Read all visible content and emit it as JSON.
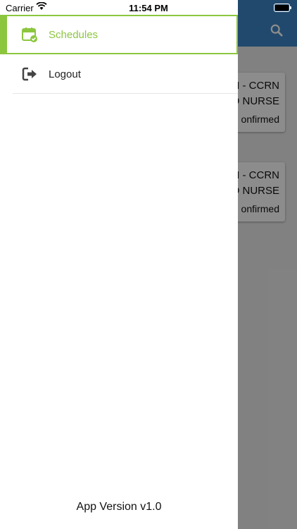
{
  "status_bar": {
    "carrier": "Carrier",
    "time": "11:54 PM"
  },
  "menu": {
    "items": [
      {
        "label": "Schedules",
        "icon": "calendar-check-icon",
        "active": true
      },
      {
        "label": "Logout",
        "icon": "logout-icon",
        "active": false
      }
    ]
  },
  "app_version": "App Version v1.0",
  "background": {
    "cards": [
      {
        "line1": "N - CCRN",
        "line2": "D NURSE",
        "status": "onfirmed"
      },
      {
        "line1": "N - CCRN",
        "line2": "D NURSE",
        "status": "onfirmed"
      }
    ]
  },
  "colors": {
    "accent": "#8cc63f",
    "header": "#3d86c6"
  }
}
